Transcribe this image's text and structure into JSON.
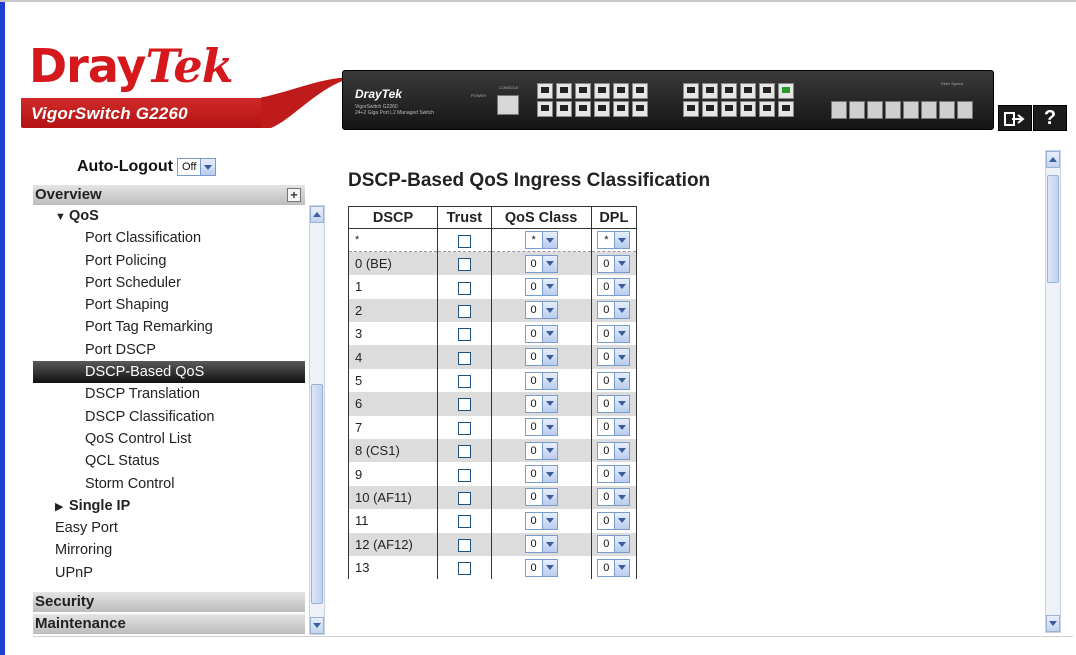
{
  "header": {
    "logo": {
      "dray": "Dray",
      "tek": "Tek"
    },
    "model": "VigorSwitch G2260",
    "panel": {
      "logo": "DrayTek",
      "sub1": "VigorSwitch G2260",
      "sub2": "24+2 Giga Port L2 Managed Switch",
      "power_label": "POWER",
      "console_label": "CONSOLE",
      "fiber_label": "Fiber Speed"
    },
    "logout_label": "⇒",
    "help_label": "?"
  },
  "sidebar": {
    "auto_logout_label": "Auto-Logout",
    "auto_logout_value": "Off",
    "overview_label": "Overview",
    "items": [
      {
        "label": "QoS",
        "level": 1,
        "expanded": true
      },
      {
        "label": "Port Classification",
        "level": 2
      },
      {
        "label": "Port Policing",
        "level": 2
      },
      {
        "label": "Port Scheduler",
        "level": 2
      },
      {
        "label": "Port Shaping",
        "level": 2
      },
      {
        "label": "Port Tag Remarking",
        "level": 2
      },
      {
        "label": "Port DSCP",
        "level": 2
      },
      {
        "label": "DSCP-Based QoS",
        "level": 2,
        "active": true
      },
      {
        "label": "DSCP Translation",
        "level": 2
      },
      {
        "label": "DSCP Classification",
        "level": 2
      },
      {
        "label": "QoS Control List",
        "level": 2
      },
      {
        "label": "QCL Status",
        "level": 2
      },
      {
        "label": "Storm Control",
        "level": 2
      },
      {
        "label": "Single IP",
        "level": 1,
        "expanded": false
      },
      {
        "label": "Easy Port",
        "level": 0
      },
      {
        "label": "Mirroring",
        "level": 0
      },
      {
        "label": "UPnP",
        "level": 0
      }
    ],
    "security_label": "Security",
    "maintenance_label": "Maintenance"
  },
  "main": {
    "title": "DSCP-Based QoS Ingress Classification",
    "columns": [
      "DSCP",
      "Trust",
      "QoS Class",
      "DPL"
    ],
    "rows": [
      {
        "dscp": "*",
        "trust": false,
        "qos_class": "*",
        "dpl": "*"
      },
      {
        "dscp": "0 (BE)",
        "trust": false,
        "qos_class": "0",
        "dpl": "0"
      },
      {
        "dscp": "1",
        "trust": false,
        "qos_class": "0",
        "dpl": "0"
      },
      {
        "dscp": "2",
        "trust": false,
        "qos_class": "0",
        "dpl": "0"
      },
      {
        "dscp": "3",
        "trust": false,
        "qos_class": "0",
        "dpl": "0"
      },
      {
        "dscp": "4",
        "trust": false,
        "qos_class": "0",
        "dpl": "0"
      },
      {
        "dscp": "5",
        "trust": false,
        "qos_class": "0",
        "dpl": "0"
      },
      {
        "dscp": "6",
        "trust": false,
        "qos_class": "0",
        "dpl": "0"
      },
      {
        "dscp": "7",
        "trust": false,
        "qos_class": "0",
        "dpl": "0"
      },
      {
        "dscp": "8 (CS1)",
        "trust": false,
        "qos_class": "0",
        "dpl": "0"
      },
      {
        "dscp": "9",
        "trust": false,
        "qos_class": "0",
        "dpl": "0"
      },
      {
        "dscp": "10 (AF11)",
        "trust": false,
        "qos_class": "0",
        "dpl": "0"
      },
      {
        "dscp": "11",
        "trust": false,
        "qos_class": "0",
        "dpl": "0"
      },
      {
        "dscp": "12 (AF12)",
        "trust": false,
        "qos_class": "0",
        "dpl": "0"
      },
      {
        "dscp": "13",
        "trust": false,
        "qos_class": "0",
        "dpl": "0"
      }
    ]
  },
  "colors": {
    "brand_red": "#d4181c",
    "active_nav": "#1a1a1a",
    "left_accent": "#1f3fd0"
  }
}
